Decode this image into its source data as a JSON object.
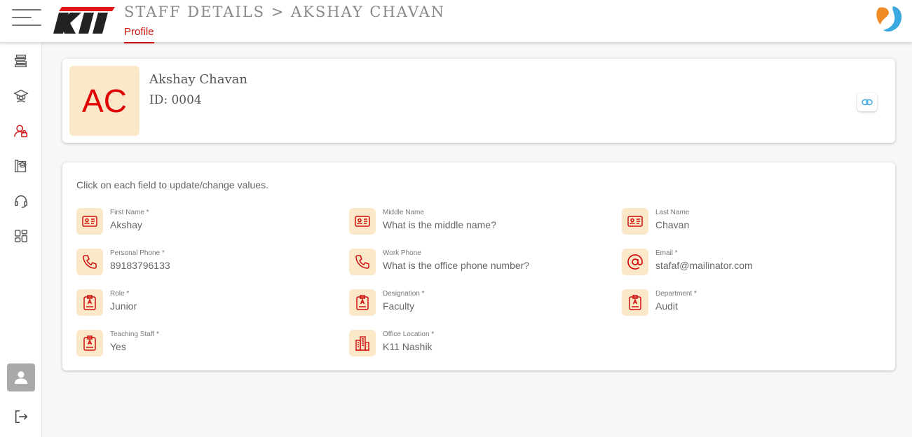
{
  "header": {
    "title": "STAFF DETAILS > AKSHAY CHAVAN",
    "active_tab": "Profile",
    "brand_logo_text": "KII",
    "accent_color": "#d01010"
  },
  "sidebar": {
    "items": [
      {
        "icon": "book-stack-icon"
      },
      {
        "icon": "graduate-student-icon"
      },
      {
        "icon": "staff-user-icon",
        "active": true
      },
      {
        "icon": "course-catalog-icon"
      },
      {
        "icon": "headset-support-icon"
      },
      {
        "icon": "dashboard-grid-icon"
      }
    ],
    "bottom": [
      {
        "icon": "user-avatar-icon"
      },
      {
        "icon": "logout-icon"
      }
    ]
  },
  "profile": {
    "initials": "AC",
    "name": "Akshay Chavan",
    "id_text": "ID: 0004"
  },
  "details": {
    "hint": "Click on each field to update/change values.",
    "fields": [
      {
        "label": "First Name *",
        "value": "Akshay",
        "icon": "id-card-icon"
      },
      {
        "label": "Middle Name",
        "value": "What is the middle name?",
        "icon": "id-card-icon"
      },
      {
        "label": "Last Name",
        "value": "Chavan",
        "icon": "id-card-icon"
      },
      {
        "label": "Personal Phone *",
        "value": "89183796133",
        "icon": "phone-icon"
      },
      {
        "label": "Work Phone",
        "value": "What is the office phone number?",
        "icon": "phone-icon"
      },
      {
        "label": "Email *",
        "value": "stafaf@mailinator.com",
        "icon": "at-sign-icon"
      },
      {
        "label": "Role *",
        "value": "Junior",
        "icon": "badge-icon"
      },
      {
        "label": "Designation *",
        "value": "Faculty",
        "icon": "badge-icon"
      },
      {
        "label": "Department *",
        "value": "Audit",
        "icon": "badge-icon"
      },
      {
        "label": "Teaching Staff *",
        "value": "Yes",
        "icon": "badge-icon"
      },
      {
        "label": "Office Location *",
        "value": "K11 Nashik",
        "icon": "office-building-icon"
      }
    ]
  }
}
